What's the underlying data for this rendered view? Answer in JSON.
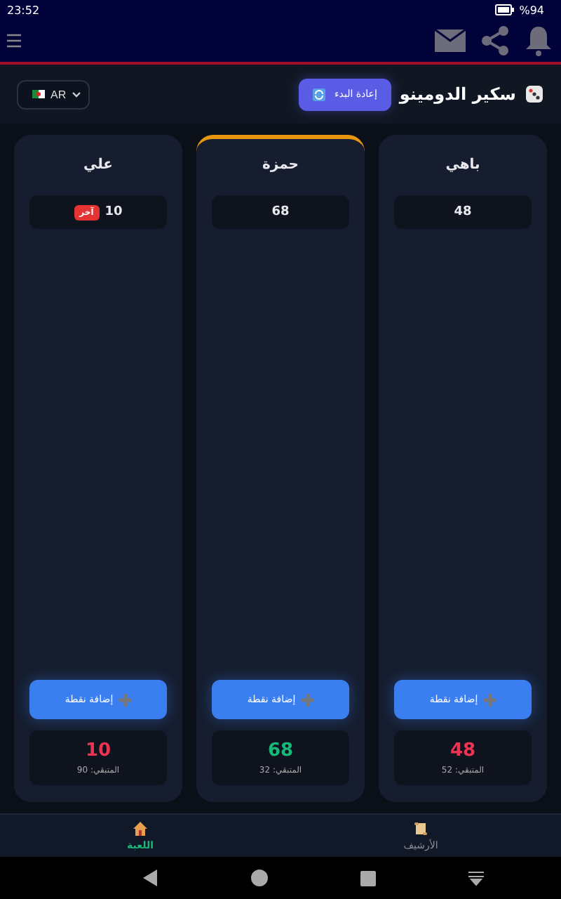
{
  "status_bar": {
    "time": "23:52",
    "battery": "%94"
  },
  "toolbar": {
    "title": "سكير الدومينو",
    "reset_button": "إعادة البدء",
    "language": "AR"
  },
  "players": [
    {
      "name": "باهي",
      "leader": false,
      "history": [
        {
          "score": "48"
        }
      ],
      "add_button": "إضافة نقطة",
      "total": "48",
      "remaining": "المتبقي: 52"
    },
    {
      "name": "حمزة",
      "leader": true,
      "history": [
        {
          "score": "68"
        }
      ],
      "add_button": "إضافة نقطة",
      "total": "68",
      "remaining": "المتبقي: 32"
    },
    {
      "name": "علي",
      "leader": false,
      "history": [
        {
          "score": "10",
          "badge": "آخر"
        }
      ],
      "add_button": "إضافة نقطة",
      "total": "10",
      "remaining": "المتبقي: 90"
    }
  ],
  "bottom_nav": [
    {
      "label": "الأرشيف",
      "kind": "archive",
      "selected": false
    },
    {
      "label": "اللعبة",
      "kind": "home",
      "selected": true
    }
  ]
}
